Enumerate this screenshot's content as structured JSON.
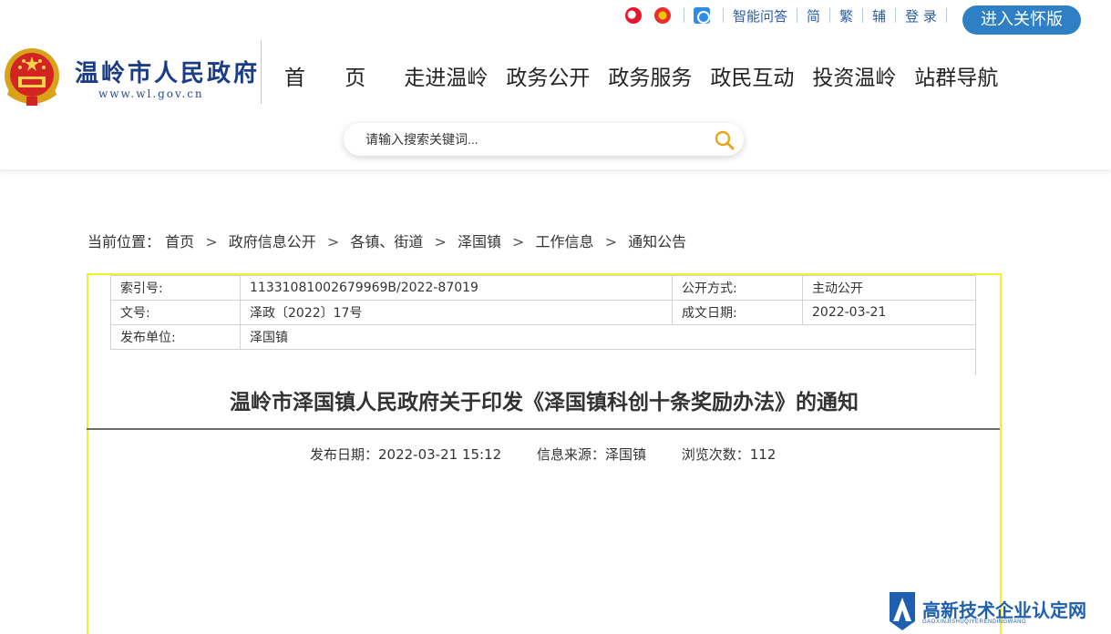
{
  "header": {
    "site_name": "温岭市人民政府",
    "site_url": "www.wl.gov.cn",
    "toplinks": {
      "icons": [
        "weibo-icon",
        "toutiao-icon",
        "wechat-icon"
      ],
      "qa": "智能问答",
      "simplified": "简",
      "traditional": "繁",
      "assist": "辅",
      "login": "登 录"
    },
    "care_button": "进入关怀版",
    "nav": [
      "首 页",
      "走进温岭",
      "政务公开",
      "政务服务",
      "政民互动",
      "投资温岭",
      "站群导航"
    ],
    "search_placeholder": "请输入搜索关键词...",
    "colors": {
      "brand_blue": "#1b3d87",
      "care_blue": "#2f7fc4",
      "frame_yellow": "#f3ef2c"
    }
  },
  "breadcrumb": {
    "label": "当前位置：",
    "items": [
      "首页",
      "政府信息公开",
      "各镇、街道",
      "泽国镇",
      "工作信息",
      "通知公告"
    ]
  },
  "meta": {
    "index_label": "索引号:",
    "index_value": "11331081002679969B/2022-87019",
    "open_label": "公开方式:",
    "open_value": "主动公开",
    "doc_no_label": "文号:",
    "doc_no_value": "泽政〔2022〕17号",
    "date_label": "成文日期:",
    "date_value": "2022-03-21",
    "issuer_label": "发布单位:",
    "issuer_value": "泽国镇"
  },
  "article": {
    "title": "温岭市泽国镇人民政府关于印发《泽国镇科创十条奖励办法》的通知",
    "publish": "发布日期：2022-03-21 15:12",
    "source": "信息来源：泽国镇",
    "views": "浏览次数：112"
  },
  "watermark": {
    "text": "高新技术企业认定网",
    "sub": "GAOXINJISHUQIYERENDINGWANG"
  }
}
